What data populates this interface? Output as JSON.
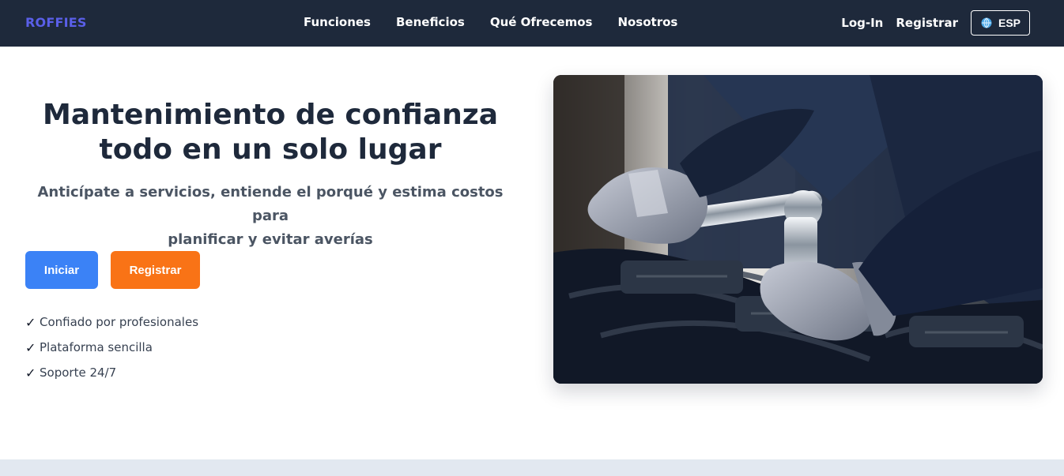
{
  "brand": {
    "name": "ROFFIES"
  },
  "nav": {
    "links": [
      "Funciones",
      "Beneficios",
      "Qué Ofrecemos",
      "Nosotros"
    ],
    "login": "Log-In",
    "register": "Registrar",
    "language": "ESP",
    "language_icon": "globe-icon"
  },
  "hero": {
    "title_line1": "Mantenimiento de confianza",
    "title_line2": "todo en un solo lugar",
    "subtitle_line1": "Anticípate a servicios, entiende el porqué y estima costos para",
    "subtitle_line2": "planificar y evitar averías",
    "primary_cta": "Iniciar",
    "secondary_cta": "Registrar",
    "features": [
      {
        "icon": "check-icon",
        "mark": "✓",
        "text": "Confiado por profesionales"
      },
      {
        "icon": "check-icon",
        "mark": "✓",
        "text": "Plataforma sencilla"
      },
      {
        "icon": "check-icon",
        "mark": "✓",
        "text": "Soporte 24/7"
      }
    ],
    "image_subject": "mechanic-wrench-engine-photo"
  },
  "colors": {
    "nav_background": "#1e293b",
    "brand": "#5a5fe8",
    "primary_button": "#3b82f6",
    "secondary_button": "#f97316",
    "title_text": "#1e293b",
    "bottom_band": "#e2e8f0"
  }
}
